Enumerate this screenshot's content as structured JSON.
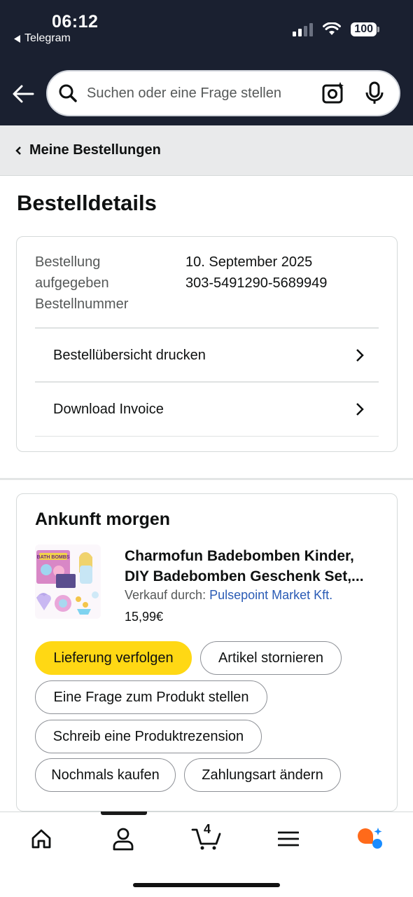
{
  "status_bar": {
    "time": "06:12",
    "back_app": "Telegram",
    "battery": "100"
  },
  "search": {
    "placeholder": "Suchen oder eine Frage stellen"
  },
  "breadcrumb": {
    "label": "Meine Bestellungen"
  },
  "page": {
    "title": "Bestelldetails"
  },
  "order": {
    "label_lines": [
      "Bestellung",
      "aufgegeben",
      "Bestellnummer"
    ],
    "date": "10. September 2025",
    "number": "303-5491290-5689949",
    "actions": [
      {
        "label": "Bestellübersicht drucken"
      },
      {
        "label": "Download Invoice"
      }
    ]
  },
  "shipment": {
    "arrival": "Ankunft morgen",
    "product": {
      "title_line1": "Charmofun Badebomben Kinder,",
      "title_line2": "DIY Badebomben Geschenk Set,...",
      "seller_prefix": "Verkauf durch:",
      "seller_name": "Pulsepoint Market Kft.",
      "price": "15,99€",
      "thumb_text": "BATH BOMBS"
    },
    "buttons": {
      "track": "Lieferung verfolgen",
      "cancel": "Artikel stornieren",
      "question": "Eine Frage zum Produkt stellen",
      "review": "Schreib eine Produktrezension",
      "buy_again": "Nochmals kaufen",
      "payment": "Zahlungsart ändern"
    }
  },
  "bottom_nav": {
    "cart_count": "4",
    "items": [
      "home-icon",
      "user-icon",
      "cart-icon",
      "menu-icon",
      "rufus-icon"
    ]
  },
  "colors": {
    "header_bg": "#1a2030",
    "primary_button": "#ffd814",
    "link": "#2a5bb5"
  }
}
